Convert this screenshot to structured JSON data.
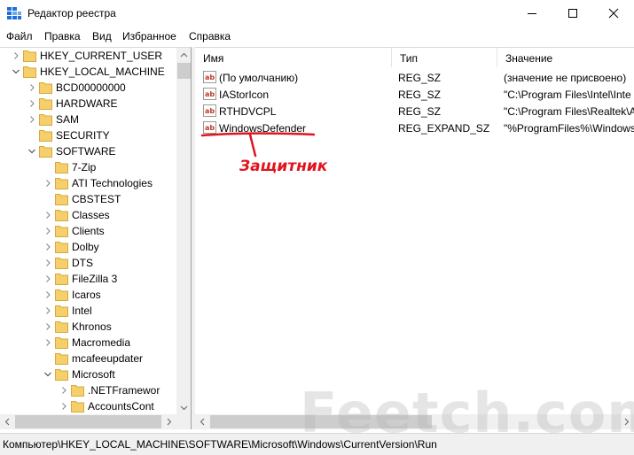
{
  "window": {
    "title": "Редактор реестра"
  },
  "menu": [
    "Файл",
    "Правка",
    "Вид",
    "Избранное",
    "Справка"
  ],
  "tree": {
    "items": [
      {
        "label": "HKEY_CURRENT_USER",
        "level": 1,
        "expanded": false
      },
      {
        "label": "HKEY_LOCAL_MACHINE",
        "level": 1,
        "expanded": true
      },
      {
        "label": "BCD00000000",
        "level": 2,
        "expanded": false
      },
      {
        "label": "HARDWARE",
        "level": 2,
        "expanded": false
      },
      {
        "label": "SAM",
        "level": 2,
        "expanded": false
      },
      {
        "label": "SECURITY",
        "level": 2,
        "expanded": null
      },
      {
        "label": "SOFTWARE",
        "level": 2,
        "expanded": true
      },
      {
        "label": "7-Zip",
        "level": 3,
        "expanded": null
      },
      {
        "label": "ATI Technologies",
        "level": 3,
        "expanded": false
      },
      {
        "label": "CBSTEST",
        "level": 3,
        "expanded": null
      },
      {
        "label": "Classes",
        "level": 3,
        "expanded": false
      },
      {
        "label": "Clients",
        "level": 3,
        "expanded": false
      },
      {
        "label": "Dolby",
        "level": 3,
        "expanded": false
      },
      {
        "label": "DTS",
        "level": 3,
        "expanded": false
      },
      {
        "label": "FileZilla 3",
        "level": 3,
        "expanded": false
      },
      {
        "label": "Icaros",
        "level": 3,
        "expanded": false
      },
      {
        "label": "Intel",
        "level": 3,
        "expanded": false
      },
      {
        "label": "Khronos",
        "level": 3,
        "expanded": false
      },
      {
        "label": "Macromedia",
        "level": 3,
        "expanded": false
      },
      {
        "label": "mcafeeupdater",
        "level": 3,
        "expanded": null
      },
      {
        "label": "Microsoft",
        "level": 3,
        "expanded": true
      },
      {
        "label": ".NETFramewor",
        "level": 4,
        "expanded": false
      },
      {
        "label": "AccountsCont",
        "level": 4,
        "expanded": false
      }
    ]
  },
  "values": {
    "columns": [
      "Имя",
      "Тип",
      "Значение"
    ],
    "rows": [
      {
        "name": "(По умолчанию)",
        "type": "REG_SZ",
        "data": "(значение не присвоено)"
      },
      {
        "name": "IAStorIcon",
        "type": "REG_SZ",
        "data": "\"C:\\Program Files\\Intel\\Inte"
      },
      {
        "name": "RTHDVCPL",
        "type": "REG_SZ",
        "data": "\"C:\\Program Files\\Realtek\\A"
      },
      {
        "name": "WindowsDefender",
        "type": "REG_EXPAND_SZ",
        "data": "\"%ProgramFiles%\\Windows"
      }
    ]
  },
  "annotation": {
    "text": "Защитник",
    "color": "#e0141e"
  },
  "watermark": "Feetch.com",
  "status": {
    "path": "Компьютер\\HKEY_LOCAL_MACHINE\\SOFTWARE\\Microsoft\\Windows\\CurrentVersion\\Run"
  },
  "colors": {
    "folder": "#f5cf6b",
    "folder_dark": "#d9a93a",
    "scroll_bg": "#f0f0f0",
    "accent_red": "#e0141e"
  },
  "icons": {
    "app": "regedit-icon",
    "folder": "folder-icon",
    "value": "string-value-icon"
  }
}
